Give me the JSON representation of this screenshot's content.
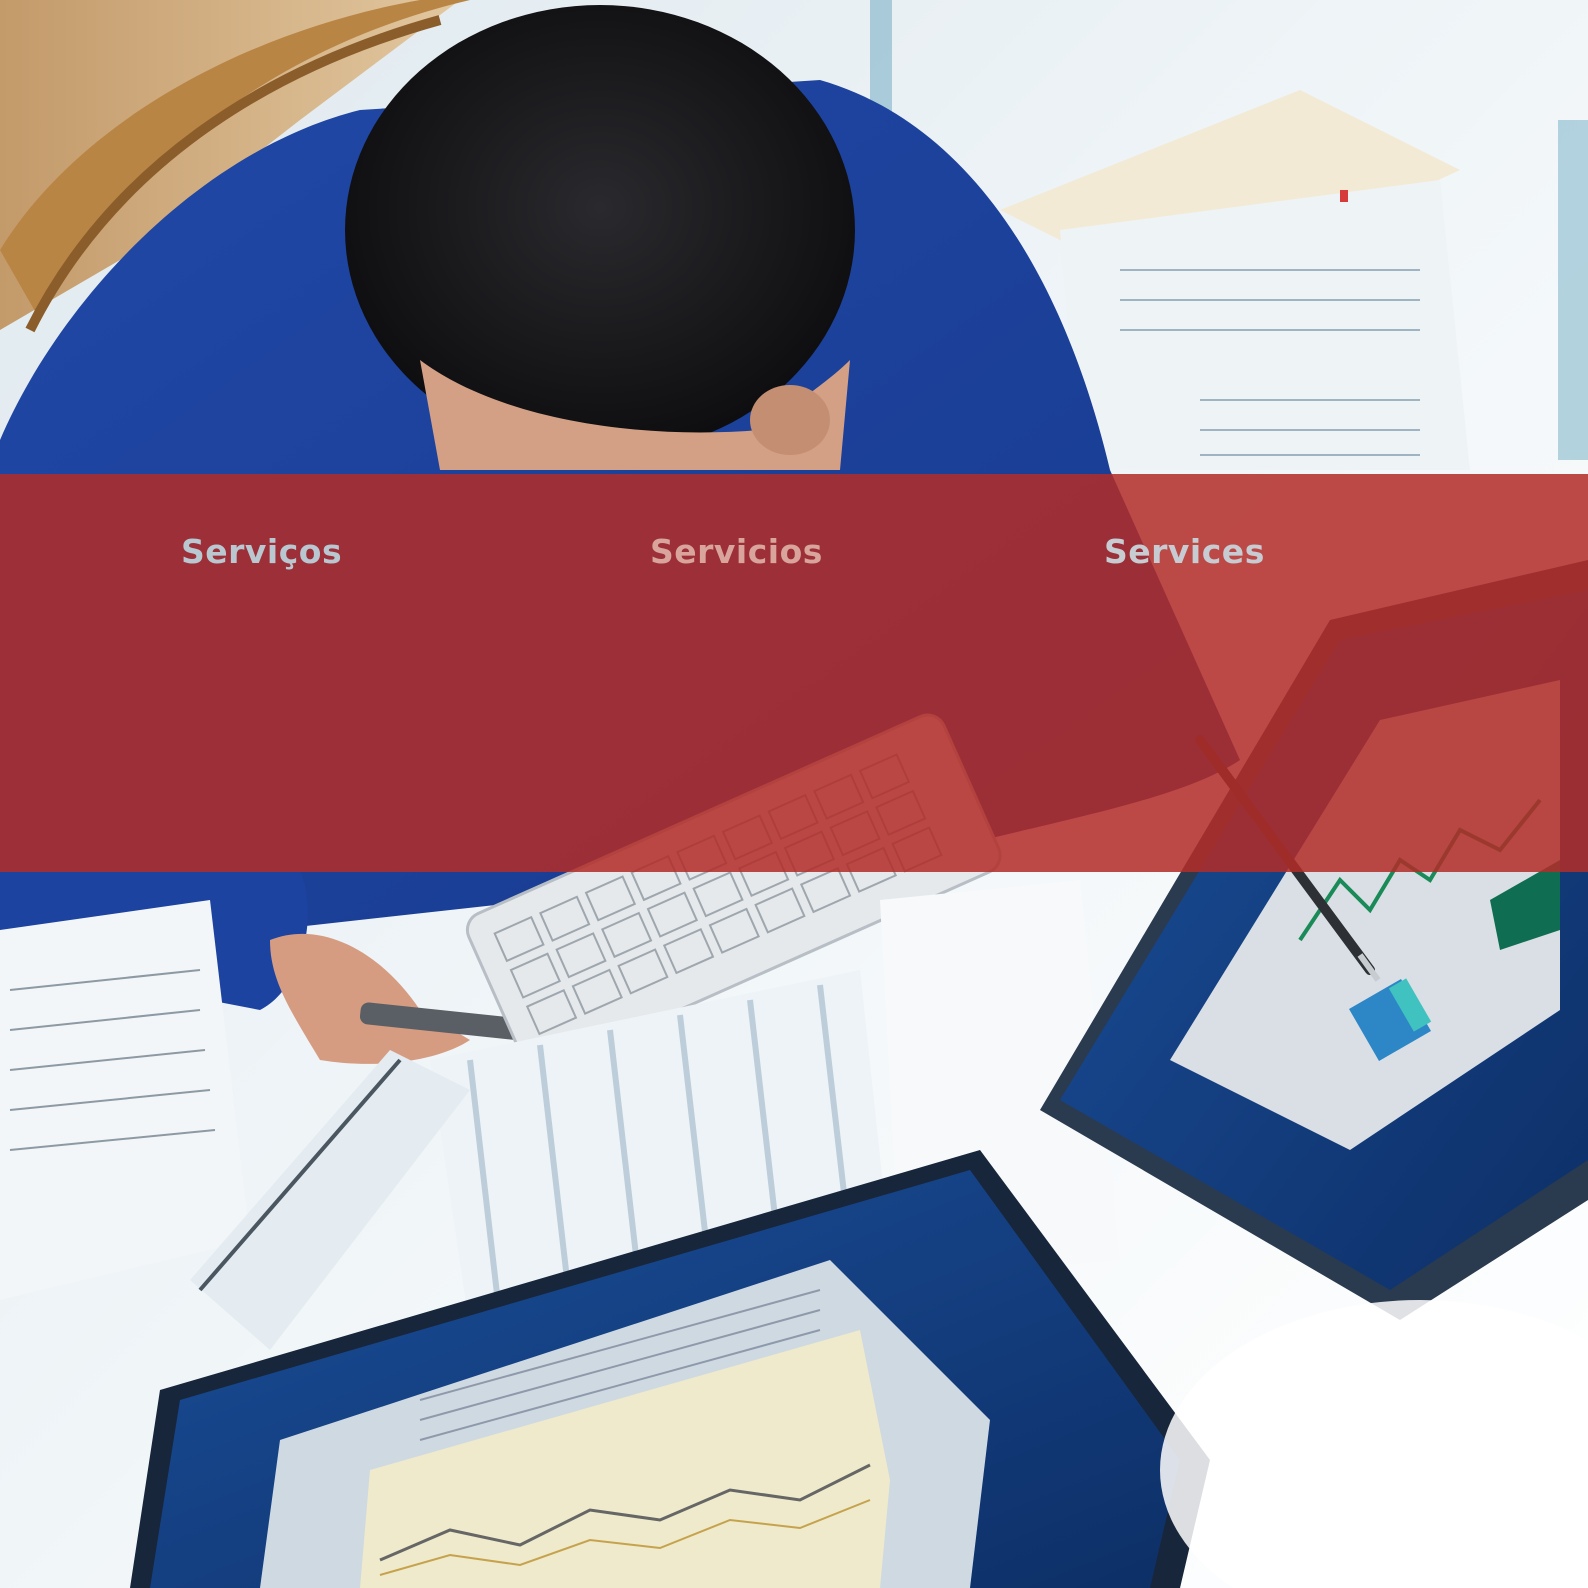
{
  "banner": {
    "color": "#b22c28",
    "items": [
      {
        "label": "Serviços",
        "color": "#b9c7d1"
      },
      {
        "label": "Servicios",
        "color": "#d9a49c"
      },
      {
        "label": "Services",
        "color": "#c6ccd2"
      }
    ]
  },
  "photo": {
    "subject": "businessman-at-desk-with-monitors-and-spreadsheets"
  }
}
